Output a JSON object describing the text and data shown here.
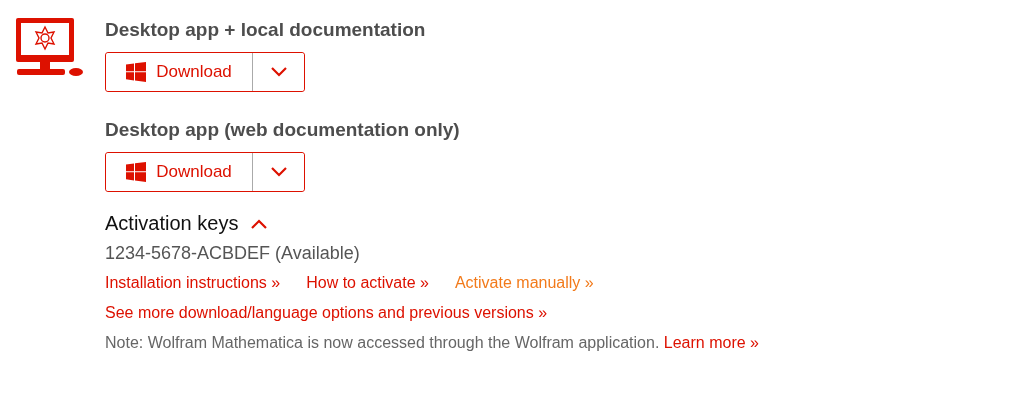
{
  "downloads": [
    {
      "title": "Desktop app + local documentation",
      "button": "Download"
    },
    {
      "title": "Desktop app (web documentation only)",
      "button": "Download"
    }
  ],
  "activation": {
    "title": "Activation keys",
    "expanded": true,
    "key": "1234-5678-ACBDEF (Available)"
  },
  "links": [
    {
      "label": "Installation instructions »",
      "color": "#dd1100"
    },
    {
      "label": "How to activate »",
      "color": "#dd1100"
    },
    {
      "label": "Activate manually »",
      "color": "#f27a1a"
    }
  ],
  "more_link": "See more download/language options and previous versions »",
  "note": {
    "text": "Note: Wolfram Mathematica is now accessed through the Wolfram application.",
    "link": "Learn more »"
  }
}
